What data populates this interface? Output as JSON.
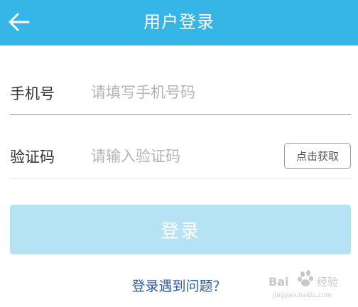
{
  "header": {
    "back_icon": "arrow-left-icon",
    "title": "用户登录",
    "background": "#35b6e6"
  },
  "form": {
    "phone": {
      "label": "手机号",
      "placeholder": "请填写手机号码",
      "value": ""
    },
    "code": {
      "label": "验证码",
      "placeholder": "请输入验证码",
      "value": "",
      "button_label": "点击获取"
    }
  },
  "login_button": {
    "label": "登录",
    "color": "#b6e3f4"
  },
  "help_link": {
    "label": "登录遇到问题？"
  },
  "watermark": {
    "brand": "Bai 经验",
    "url": "jingyan.baidu.com"
  }
}
